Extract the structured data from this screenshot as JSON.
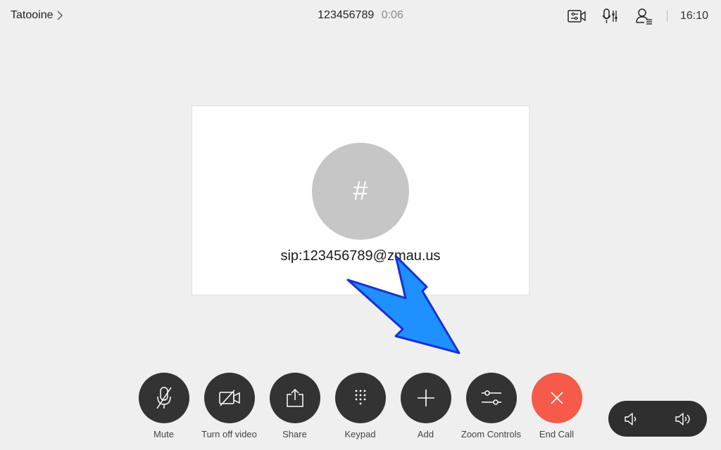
{
  "header": {
    "room_name": "Tatooine",
    "number": "123456789",
    "duration": "0:06",
    "time": "16:10",
    "icons": [
      "self-view-icon",
      "audio-controls-icon",
      "participants-icon"
    ]
  },
  "participant": {
    "avatar_glyph": "#",
    "address": "sip:123456789@zmau.us"
  },
  "controls": [
    {
      "label": "Mute",
      "icon": "microphone-muted-icon"
    },
    {
      "label": "Turn off video",
      "icon": "camera-off-icon"
    },
    {
      "label": "Share",
      "icon": "share-icon"
    },
    {
      "label": "Keypad",
      "icon": "keypad-icon"
    },
    {
      "label": "Add",
      "icon": "plus-icon"
    },
    {
      "label": "Zoom Controls",
      "icon": "sliders-icon"
    },
    {
      "label": "End Call",
      "icon": "close-icon"
    }
  ],
  "volume": {
    "icons": [
      "volume-down-icon",
      "volume-up-icon"
    ]
  },
  "colors": {
    "background": "#efefef",
    "button": "#333333",
    "end_call": "#f65a4a",
    "arrow_fill": "#1e90ff",
    "arrow_stroke": "#1a2fd6"
  }
}
